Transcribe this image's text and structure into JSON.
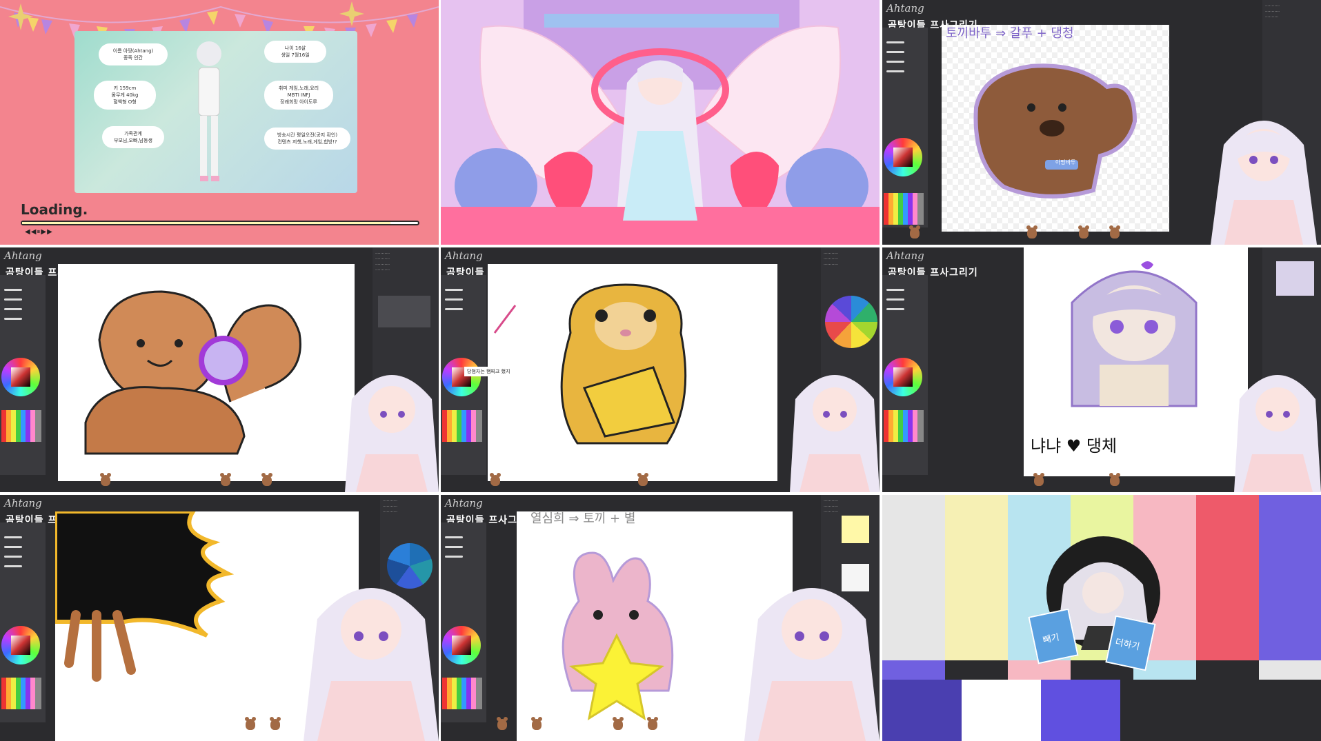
{
  "tiles": {
    "loading": {
      "loading_text": "Loading.",
      "player_controls": "◀◀⏸▶▶",
      "progress": 0.93,
      "profile": {
        "name": "이름 아땅(Ahtang)\n종족 인간",
        "age": "나이 16살\n생일 7월16일",
        "height": "키 159cm\n몸무게 40kg\n혈액형 O형",
        "hobby": "취미 게임,노래,요리\nMBTI INFJ\n장래희망 아이도루",
        "family": "가족관계\n부모님,오빠,남동생",
        "content": "방송시간 평일오전(공지 확인)\n컨텐츠 저챗,노래,게임,합방!?"
      }
    },
    "drawing_title": "곰탕이들 프사그리기",
    "logo": "Ahtang",
    "tile3_heading": "토끼바투 ⇒ 갈푸 + 댕청",
    "tile3_tag": "아땅바투",
    "tile5_caption": "당첨자는 햄찌크 했지",
    "tile6_caption": "냐냐 ♥ 댕체",
    "tile8_heading": "열심희 ⇒ 토끼 + 별",
    "tile9_cup_left": "빼기",
    "tile9_cup_right": "더하기"
  },
  "colors": {
    "pink_bg": "#f3848e",
    "panel_dark": "#2b2b2e",
    "accent_purple": "#9b6ad8"
  }
}
